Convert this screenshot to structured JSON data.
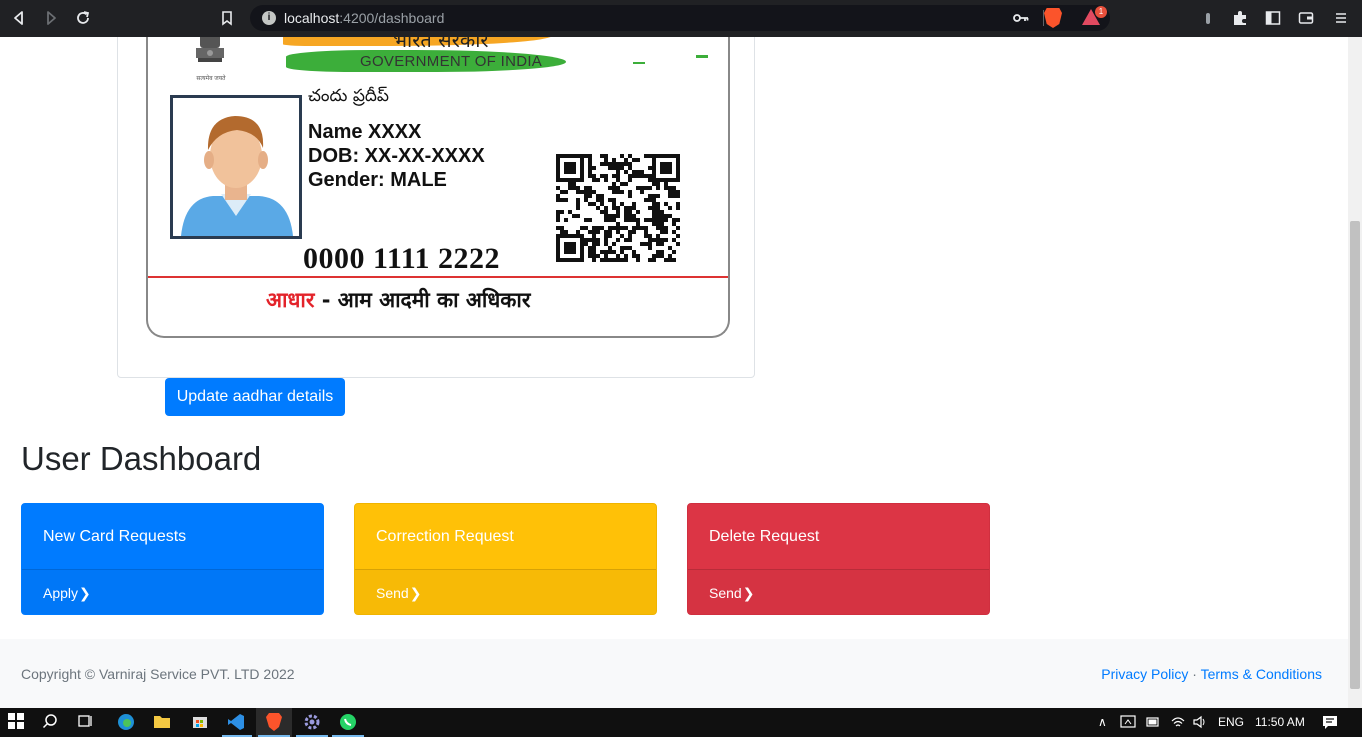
{
  "browser": {
    "url_host": "localhost",
    "url_rest": ":4200/dashboard",
    "extension_badge": "1"
  },
  "aadhaar_card": {
    "hindi_gov": "भारत सरकार",
    "gov_label": "GOVERNMENT OF INDIA",
    "emblem_caption": "सत्यमेव जयते",
    "telugu_name": "చందు ప్రదీప్",
    "name_line": "Name XXXX",
    "dob_line": "DOB: XX-XX-XXXX",
    "gender_line": "Gender: MALE",
    "number": "0000 1111 2222",
    "tagline_red": "आधार",
    "tagline_rest": " - आम आदमी का अधिकार"
  },
  "update_button": "Update aadhar details",
  "dashboard": {
    "title": "User Dashboard",
    "tiles": [
      {
        "title": "New Card Requests",
        "action": "Apply",
        "color": "#007bff"
      },
      {
        "title": "Correction Request",
        "action": "Send",
        "color": "#ffc107"
      },
      {
        "title": "Delete Request",
        "action": "Send",
        "color": "#dc3545"
      }
    ]
  },
  "footer": {
    "copyright": "Copyright © Varniraj Service PVT. LTD 2022",
    "privacy": "Privacy Policy",
    "separator": "·",
    "terms": "Terms & Conditions"
  },
  "taskbar": {
    "language": "ENG",
    "time": "11:50 AM"
  }
}
